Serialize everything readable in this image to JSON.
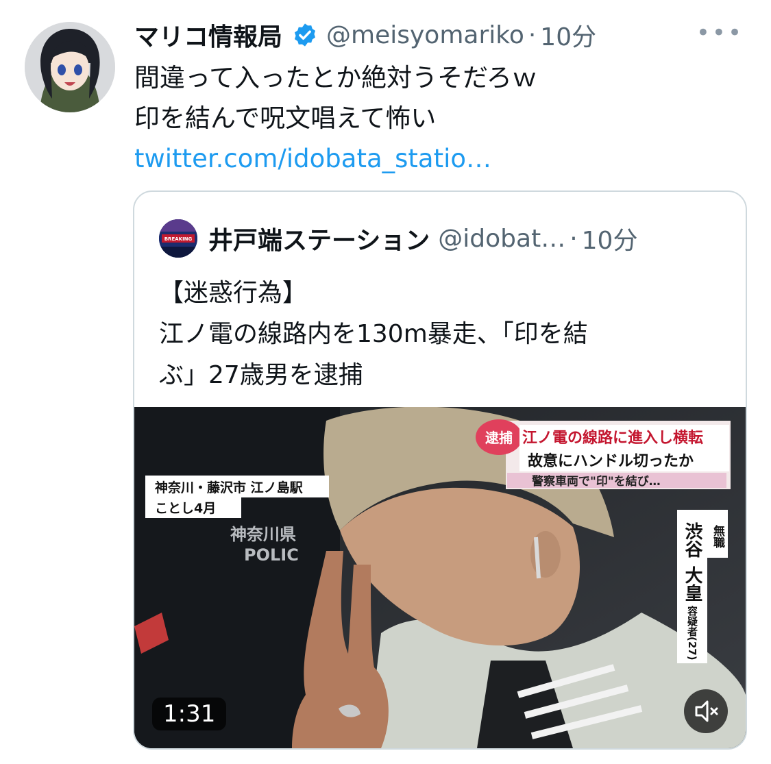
{
  "tweet": {
    "author_name": "マリコ情報局",
    "handle": "@meisyomariko",
    "separator": "·",
    "time": "10分",
    "text_line1": "間違って入ったとか絶対うそだろｗ",
    "text_line2": "印を結んで呪文唱えて怖い",
    "link": "twitter.com/idobata_statio…"
  },
  "quote": {
    "author_name": "井戸端ステーション",
    "handle": "@idobat…",
    "separator": "·",
    "time": "10分",
    "text_line1": "【迷惑行為】",
    "text_line2": "江ノ電の線路内を130m暴走、「印を結",
    "text_line3": "ぶ」27歳男を逮捕",
    "avatar_label": "BREAKING"
  },
  "video": {
    "duration": "1:31",
    "caption_location_line1": "神奈川・藤沢市 江ノ島駅",
    "caption_location_line2": "ことし4月",
    "arrest_badge": "逮捕",
    "headline_line1": "江ノ電の線路に進入し横転",
    "headline_line2": "故意にハンドル切ったか",
    "headline_line3": "警察車両で\"印\"を結び…",
    "name_occupation": "無職",
    "name_surname": "渋谷",
    "name_given": "大皇",
    "name_suffix": "容疑者(27)",
    "police_text1": "神奈川県",
    "police_text2": "POLIC"
  },
  "colors": {
    "link": "#1d9bf0",
    "verified": "#1d9bf0",
    "secondary_text": "#536471",
    "border": "#cfd9de"
  },
  "icons": {
    "more": "more-horizontal-icon",
    "verified": "verified-badge-icon",
    "mute": "volume-muted-icon"
  }
}
